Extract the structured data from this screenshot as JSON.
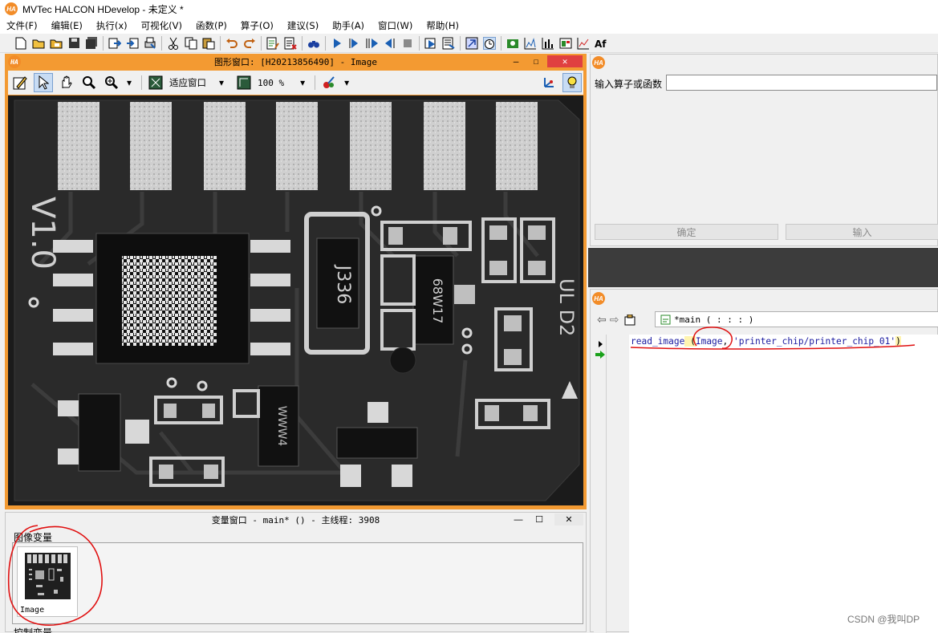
{
  "app": {
    "title": "MVTec HALCON HDevelop - 未定义 *"
  },
  "menu": [
    "文件(F)",
    "编辑(E)",
    "执行(x)",
    "可视化(V)",
    "函数(P)",
    "算子(O)",
    "建议(S)",
    "助手(A)",
    "窗口(W)",
    "帮助(H)"
  ],
  "graphics_window": {
    "title": "图形窗口: [H20213856490] - Image",
    "fit_label": "适应窗口",
    "zoom_label": "100 %",
    "image_text": {
      "version": "V1.0",
      "chip_code_1": "J336",
      "chip_code_2": "68W17",
      "chip_code_3": "WWW4",
      "side_mark": "UL D2"
    }
  },
  "variable_window": {
    "title": "变量窗口 - main* () - 主线程: 3908",
    "section_iconic": "图像变量",
    "thumbnail_label": "Image",
    "section_control": "控制变量"
  },
  "operator_window": {
    "label": "输入算子或函数",
    "input_value": "",
    "ok_button": "确定",
    "enter_button": "输入"
  },
  "program_window": {
    "procedure": "*main ( : : : )",
    "code_line": {
      "op": "read_image",
      "open": " (",
      "arg1": "Image",
      "comma": ", ",
      "arg2": "'printer_chip/printer_chip_01'",
      "close": ")"
    }
  },
  "watermark": "CSDN @我叫DP",
  "colors": {
    "accent": "#f39a32",
    "annotation": "#e01010",
    "program_counter": "#1aa11a"
  }
}
